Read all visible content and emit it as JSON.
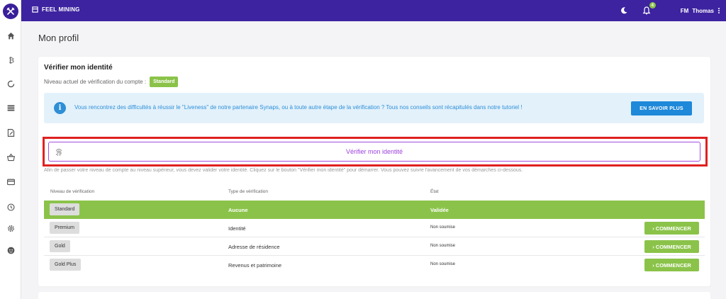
{
  "topbar": {
    "brand": "FEEL MINING",
    "notification_count": "4",
    "user_initials": "FM",
    "user_name": "Thomas"
  },
  "sidebar": {
    "icons": [
      "home-icon",
      "bitcoin-icon",
      "refresh-icon",
      "list-icon",
      "edit-document-icon",
      "basket-icon",
      "wallet-icon",
      "history-icon",
      "settings-icon",
      "support-icon"
    ]
  },
  "page": {
    "title": "Mon profil"
  },
  "verify": {
    "title": "Vérifier mon identité",
    "level_label": "Niveau actuel de vérification du compte :",
    "level_value": "Standard",
    "alert_text": "Vous rencontrez des difficultés à réussir le \"Liveness\" de notre partenaire Synaps, ou à toute autre étape de la vérification ? Tous nos conseils sont récapitulés dans notre tutoriel !",
    "alert_button": "EN SAVOIR PLUS",
    "verify_button": "Vérifier mon identité",
    "help_text": "Afin de passer votre niveau de compte au niveau supérieur, vous devez valider votre identité. Cliquez sur le bouton \"Vérifier mon identité\" pour démarrer. Vous pouvez suivre l'avancement de vos démarches ci-dessous."
  },
  "table": {
    "headers": [
      "Niveau de vérification",
      "Type de vérification",
      "État"
    ],
    "rows": [
      {
        "level": "Standard",
        "type": "Aucune",
        "state": "Validée",
        "action": ""
      },
      {
        "level": "Premium",
        "type": "Identité",
        "state": "Non soumise",
        "action": "› COMMENCER"
      },
      {
        "level": "Gold",
        "type": "Adresse de résidence",
        "state": "Non soumise",
        "action": "› COMMENCER"
      },
      {
        "level": "Gold Plus",
        "type": "Revenus et patrimoine",
        "state": "Non soumise",
        "action": "› COMMENCER"
      }
    ]
  },
  "colors": {
    "topbar": "#3d23a0",
    "accent_green": "#8bc34a",
    "info_blue": "#1e88d9",
    "verify_purple": "#9c3fde",
    "highlight_red": "#e02020"
  }
}
